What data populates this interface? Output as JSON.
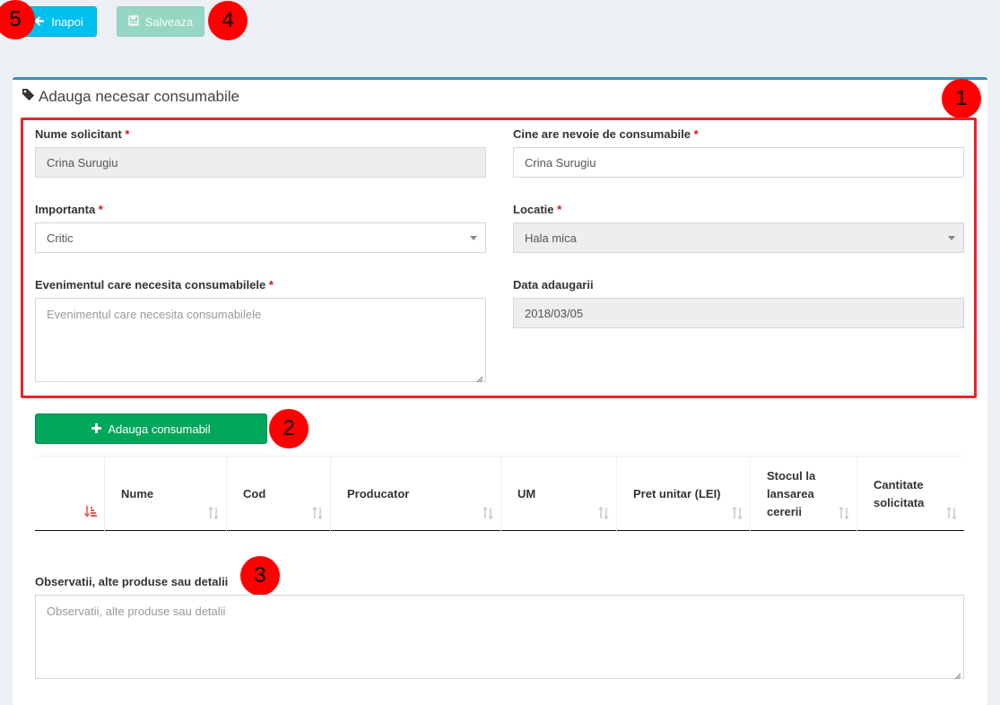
{
  "toolbar": {
    "back_label": "Inapoi",
    "save_label": "Salveaza"
  },
  "markers": {
    "m1": "1",
    "m2": "2",
    "m3": "3",
    "m4": "4",
    "m5": "5"
  },
  "form": {
    "title": "Adauga necesar consumabile",
    "required_mark": "*",
    "requester": {
      "label": "Nume solicitant",
      "value": "Crina Surugiu"
    },
    "who_needs": {
      "label": "Cine are nevoie de consumabile",
      "value": "Crina Surugiu"
    },
    "importance": {
      "label": "Importanta",
      "value": "Critic"
    },
    "location": {
      "label": "Locatie",
      "value": "Hala mica"
    },
    "event": {
      "label": "Evenimentul care necesita consumabilele",
      "placeholder": "Evenimentul care necesita consumabilele"
    },
    "date_added": {
      "label": "Data adaugarii",
      "value": "2018/03/05"
    }
  },
  "add_button_label": "Adauga consumabil",
  "table": {
    "columns": [
      {
        "label": ""
      },
      {
        "label": "Nume"
      },
      {
        "label": "Cod"
      },
      {
        "label": "Producator"
      },
      {
        "label": "UM"
      },
      {
        "label": "Pret unitar (LEI)"
      },
      {
        "label": "Stocul la lansarea cererii"
      },
      {
        "label": "Cantitate solicitata"
      }
    ]
  },
  "notes": {
    "label": "Observatii, alte produse sau detalii",
    "placeholder": "Observatii, alte produse sau detalii"
  },
  "colors": {
    "info": "#00c0ef",
    "success": "#00a65a",
    "primary_border": "#3c8dbc",
    "marker": "#ff0000",
    "highlight": "#e8242b",
    "required": "#dd1010"
  }
}
